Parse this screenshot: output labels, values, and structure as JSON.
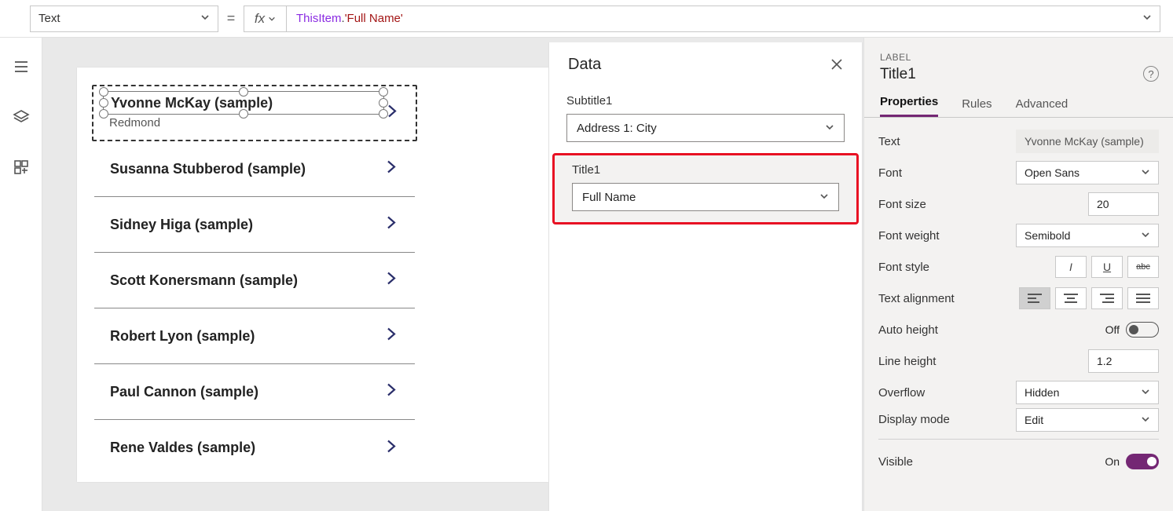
{
  "formula": {
    "property": "Text",
    "fx_label": "fx",
    "expr_this": "ThisItem",
    "expr_dot": ".",
    "expr_prop": "'Full Name'",
    "equals": "="
  },
  "gallery": {
    "selected": {
      "title": "Yvonne McKay (sample)",
      "subtitle": "Redmond"
    },
    "items": [
      "Susanna Stubberod (sample)",
      "Sidney Higa (sample)",
      "Scott Konersmann (sample)",
      "Robert Lyon (sample)",
      "Paul Cannon (sample)",
      "Rene Valdes (sample)"
    ]
  },
  "data_pane": {
    "title": "Data",
    "subtitle1": {
      "label": "Subtitle1",
      "value": "Address 1: City"
    },
    "title1": {
      "label": "Title1",
      "value": "Full Name"
    }
  },
  "props": {
    "section": "LABEL",
    "control": "Title1",
    "tabs": [
      "Properties",
      "Rules",
      "Advanced"
    ],
    "text": {
      "k": "Text",
      "v": "Yvonne McKay (sample)"
    },
    "font": {
      "k": "Font",
      "v": "Open Sans"
    },
    "font_size": {
      "k": "Font size",
      "v": "20"
    },
    "font_weight": {
      "k": "Font weight",
      "v": "Semibold"
    },
    "font_style": {
      "k": "Font style"
    },
    "text_align": {
      "k": "Text alignment"
    },
    "auto_h": {
      "k": "Auto height",
      "v": "Off"
    },
    "line_h": {
      "k": "Line height",
      "v": "1.2"
    },
    "overflow": {
      "k": "Overflow",
      "v": "Hidden"
    },
    "display_mode": {
      "k": "Display mode",
      "v": "Edit"
    },
    "visible": {
      "k": "Visible",
      "v": "On"
    }
  }
}
